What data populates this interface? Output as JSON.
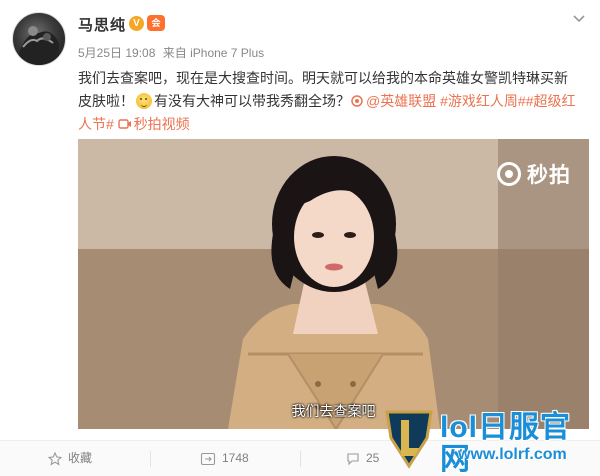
{
  "post": {
    "username": "马思纯",
    "verified_badge": "V",
    "vip_badge": "会",
    "timestamp": "5月25日 19:08",
    "source_prefix": "来自",
    "source": "iPhone 7 Plus",
    "text_part1": "我们去查案吧，现在是大搜查时间。明天就可以给我的本命英雄女警凯特琳买新皮肤啦！",
    "text_part2": "有没有大神可以带我秀翻全场？",
    "mention": "@英雄联盟",
    "hashtag1": "#游戏红人周#",
    "hashtag2": "#超级红人节#",
    "video_link": "秒拍视频",
    "icons": {
      "chevron": "chevron-down-icon",
      "mention": "at-icon",
      "video": "video-icon"
    }
  },
  "video": {
    "brand": "秒拍",
    "subtitle": "我们去查案吧"
  },
  "actions": {
    "favorite_label": "收藏",
    "repost_count": "1748",
    "comment_count": "25"
  },
  "watermark": {
    "title": "lol日服官网",
    "url": "www.lolrf.com"
  },
  "colors": {
    "link": "#eb7350",
    "watermark": "#1a8fd8",
    "badge_v": "#f5a623"
  }
}
